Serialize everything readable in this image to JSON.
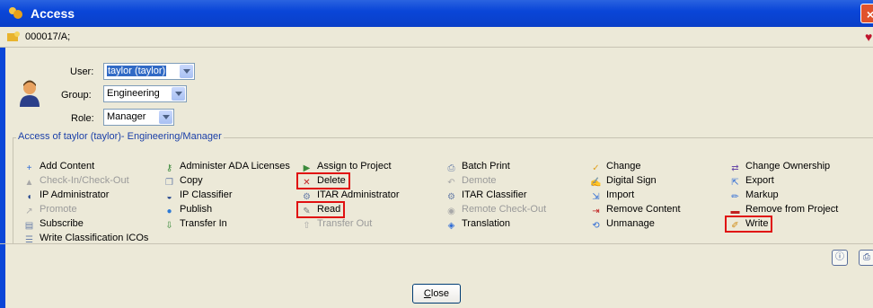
{
  "window": {
    "title": "Access",
    "close_symbol": "×"
  },
  "crumb": {
    "text": "000017/A;"
  },
  "form": {
    "user_label": "User:",
    "user_value": "taylor (taylor)",
    "group_label": "Group:",
    "group_value": "Engineering",
    "role_label": "Role:",
    "role_value": "Manager"
  },
  "access_group": {
    "title": "Access of taylor (taylor)- Engineering/Manager"
  },
  "privileges": [
    {
      "label": "Add Content",
      "icon": "add-content-icon",
      "enabled": true
    },
    {
      "label": "Check-In/Check-Out",
      "icon": "check-in-out-icon",
      "enabled": false
    },
    {
      "label": "IP Administrator",
      "icon": "ip-admin-icon",
      "enabled": true
    },
    {
      "label": "Promote",
      "icon": "promote-icon",
      "enabled": false
    },
    {
      "label": "Subscribe",
      "icon": "subscribe-icon",
      "enabled": true
    },
    {
      "label": "Write Classification ICOs",
      "icon": "classification-icon",
      "enabled": true
    },
    {
      "label": "Administer ADA Licenses",
      "icon": "ada-license-icon",
      "enabled": true
    },
    {
      "label": "Copy",
      "icon": "copy-icon",
      "enabled": true
    },
    {
      "label": "IP Classifier",
      "icon": "ip-classifier-icon",
      "enabled": true
    },
    {
      "label": "Publish",
      "icon": "publish-icon",
      "enabled": true
    },
    {
      "label": "Transfer In",
      "icon": "transfer-in-icon",
      "enabled": true
    },
    {
      "label": "Assign to Project",
      "icon": "assign-project-icon",
      "enabled": true
    },
    {
      "label": "Delete",
      "icon": "delete-icon",
      "enabled": true,
      "highlighted": true
    },
    {
      "label": "ITAR Administrator",
      "icon": "itar-admin-icon",
      "enabled": true
    },
    {
      "label": "Read",
      "icon": "read-icon",
      "enabled": true,
      "highlighted": true
    },
    {
      "label": "Transfer Out",
      "icon": "transfer-out-icon",
      "enabled": false
    },
    {
      "label": "Batch Print",
      "icon": "batch-print-icon",
      "enabled": true
    },
    {
      "label": "Demote",
      "icon": "demote-icon",
      "enabled": false
    },
    {
      "label": "ITAR Classifier",
      "icon": "itar-classifier-icon",
      "enabled": true
    },
    {
      "label": "Remote Check-Out",
      "icon": "remote-checkout-icon",
      "enabled": false
    },
    {
      "label": "Translation",
      "icon": "translation-icon",
      "enabled": true
    },
    {
      "label": "Change",
      "icon": "change-icon",
      "enabled": true
    },
    {
      "label": "Digital Sign",
      "icon": "digital-sign-icon",
      "enabled": true
    },
    {
      "label": "Import",
      "icon": "import-icon",
      "enabled": true
    },
    {
      "label": "Remove Content",
      "icon": "remove-content-icon",
      "enabled": true
    },
    {
      "label": "Unmanage",
      "icon": "unmanage-icon",
      "enabled": true
    },
    {
      "label": "Change Ownership",
      "icon": "change-ownership-icon",
      "enabled": true
    },
    {
      "label": "Export",
      "icon": "export-icon",
      "enabled": true
    },
    {
      "label": "Markup",
      "icon": "markup-icon",
      "enabled": true
    },
    {
      "label": "Remove from Project",
      "icon": "remove-project-icon",
      "enabled": true
    },
    {
      "label": "Write",
      "icon": "write-icon",
      "enabled": true,
      "highlighted": true
    }
  ],
  "footer": {
    "close_label_first": "C",
    "close_label_rest": "lose"
  },
  "colors": {
    "highlight": "#e01010",
    "title_bar": "#0a46d8",
    "group_title": "#1a3fa8"
  }
}
